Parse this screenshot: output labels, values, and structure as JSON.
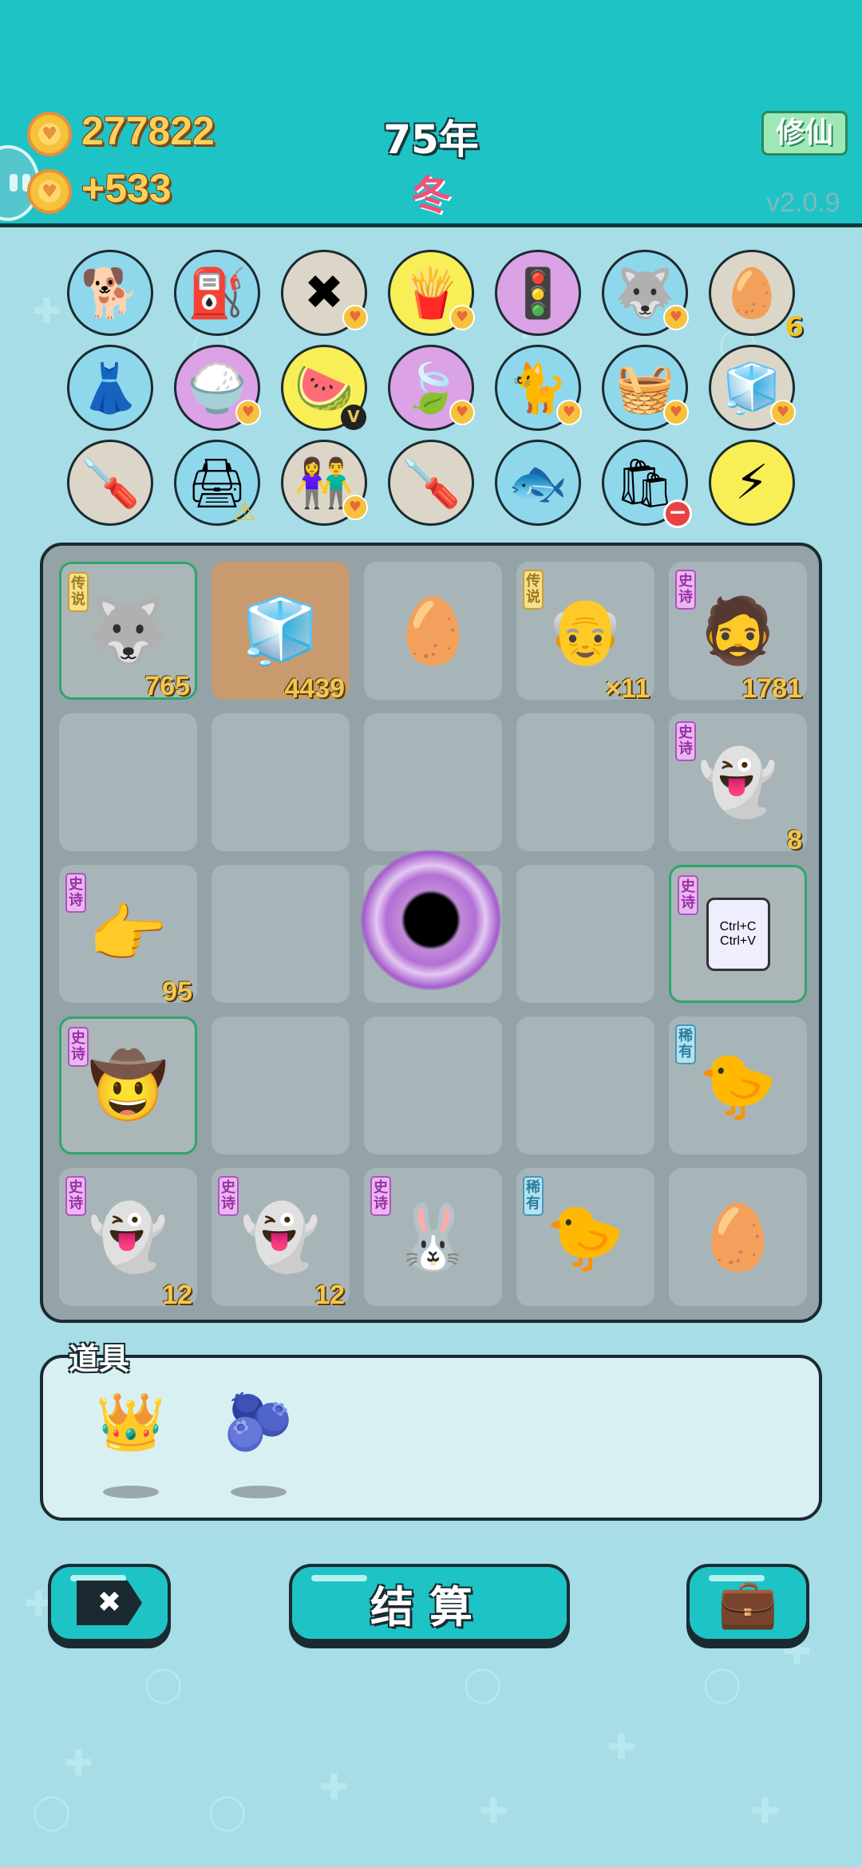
{
  "header": {
    "coins": "277822",
    "income": "+533",
    "year": "75年",
    "season": "冬",
    "mode_button": "修仙",
    "version": "v2.0.9"
  },
  "item_rows": [
    [
      {
        "icon": "shiba-dog-icon",
        "glyph": "🐕",
        "bg": "#8fd8ec"
      },
      {
        "icon": "air-pump-icon",
        "glyph": "⛽",
        "bg": "#8fd8ec"
      },
      {
        "icon": "delete-tag-icon",
        "glyph": "✖",
        "bg": "#dcd6c8",
        "heart": true
      },
      {
        "icon": "french-fries-icon",
        "glyph": "🍟",
        "bg": "#f7ef55",
        "heart": true
      },
      {
        "icon": "ghost-traffic-light-icon",
        "glyph": "🚦",
        "bg": "#dba2e6"
      },
      {
        "icon": "husky-dog-icon",
        "glyph": "🐺",
        "bg": "#8fd8ec",
        "heart": true
      },
      {
        "icon": "egg-tray-icon",
        "glyph": "🥚",
        "bg": "#dcd6c8",
        "count": "6"
      }
    ],
    [
      {
        "icon": "skirt-icon",
        "glyph": "👗",
        "bg": "#8fd8ec"
      },
      {
        "icon": "rice-bowl-icon",
        "glyph": "🍚",
        "bg": "#dba2e6",
        "heart": true
      },
      {
        "icon": "fruit-platter-icon",
        "glyph": "🍉",
        "bg": "#f7ef55",
        "v": true
      },
      {
        "icon": "leaf-icon",
        "glyph": "🍃",
        "bg": "#dba2e6",
        "heart": true
      },
      {
        "icon": "cat-icon",
        "glyph": "🐈",
        "bg": "#8fd8ec",
        "heart": true
      },
      {
        "icon": "fruit-basket-icon",
        "glyph": "🧺",
        "bg": "#8fd8ec",
        "heart": true
      },
      {
        "icon": "sugar-cubes-icon",
        "glyph": "🧊",
        "bg": "#dcd6c8",
        "heart": true
      }
    ],
    [
      {
        "icon": "screwdriver-icon",
        "glyph": "🪛",
        "bg": "#dcd6c8"
      },
      {
        "icon": "printer-icon",
        "glyph": "🖨",
        "bg": "#8fd8ec",
        "warn": true
      },
      {
        "icon": "couple-icon",
        "glyph": "👫",
        "bg": "#dcd6c8",
        "heart": true
      },
      {
        "icon": "screwdriver-icon",
        "glyph": "🪛",
        "bg": "#dcd6c8"
      },
      {
        "icon": "fish-tank-icon",
        "glyph": "🐟",
        "bg": "#8fd8ec"
      },
      {
        "icon": "trash-bag-icon",
        "glyph": "🛍",
        "bg": "#8fd8ec",
        "minus": true
      },
      {
        "icon": "lightning-icon",
        "glyph": "⚡",
        "bg": "#f7ef55"
      }
    ]
  ],
  "board": [
    {
      "name": "husky-king",
      "glyph": "🐺",
      "tag": "传说",
      "tag_type": "legend",
      "count": "765",
      "hl": true
    },
    {
      "name": "fridge",
      "glyph": "🧊",
      "count": "4439",
      "orange": true
    },
    {
      "name": "egg",
      "glyph": "🥚"
    },
    {
      "name": "old-man-glasses",
      "glyph": "👴",
      "tag": "传说",
      "tag_type": "legend",
      "count": "×11"
    },
    {
      "name": "bearded-man",
      "glyph": "🧔",
      "tag": "史诗",
      "tag_type": "epic",
      "count": "1781"
    },
    {
      "name": "empty"
    },
    {
      "name": "empty"
    },
    {
      "name": "empty"
    },
    {
      "name": "empty"
    },
    {
      "name": "ghost",
      "glyph": "👻",
      "tag": "史诗",
      "tag_type": "epic",
      "count": "8"
    },
    {
      "name": "pointing-hand",
      "glyph": "👉",
      "tag": "史诗",
      "tag_type": "epic",
      "count": "95"
    },
    {
      "name": "empty"
    },
    {
      "name": "black-hole"
    },
    {
      "name": "empty"
    },
    {
      "name": "copy-paste-card",
      "glyph": "📋",
      "tag": "史诗",
      "tag_type": "epic",
      "hl": true,
      "text1": "Ctrl+C",
      "text2": "Ctrl+V"
    },
    {
      "name": "cowboy-man",
      "glyph": "🤠",
      "tag": "史诗",
      "tag_type": "epic",
      "hl": true
    },
    {
      "name": "empty"
    },
    {
      "name": "empty"
    },
    {
      "name": "empty"
    },
    {
      "name": "chick",
      "glyph": "🐤",
      "tag": "稀有",
      "tag_type": "rare"
    },
    {
      "name": "ghost",
      "glyph": "👻",
      "tag": "史诗",
      "tag_type": "epic",
      "count": "12"
    },
    {
      "name": "ghost",
      "glyph": "👻",
      "tag": "史诗",
      "tag_type": "epic",
      "count": "12"
    },
    {
      "name": "rabbit-tent",
      "glyph": "🐰",
      "tag": "史诗",
      "tag_type": "epic"
    },
    {
      "name": "chick",
      "glyph": "🐤",
      "tag": "稀有",
      "tag_type": "rare"
    },
    {
      "name": "egg",
      "glyph": "🥚"
    }
  ],
  "tools": {
    "title": "道具",
    "items": [
      {
        "icon": "crown-icon",
        "glyph": "👑"
      },
      {
        "icon": "blueberry-icon",
        "glyph": "🫐"
      }
    ]
  },
  "buttons": {
    "remove_icon": "✖",
    "settle_label": "结算",
    "bag_icon": "💼"
  }
}
